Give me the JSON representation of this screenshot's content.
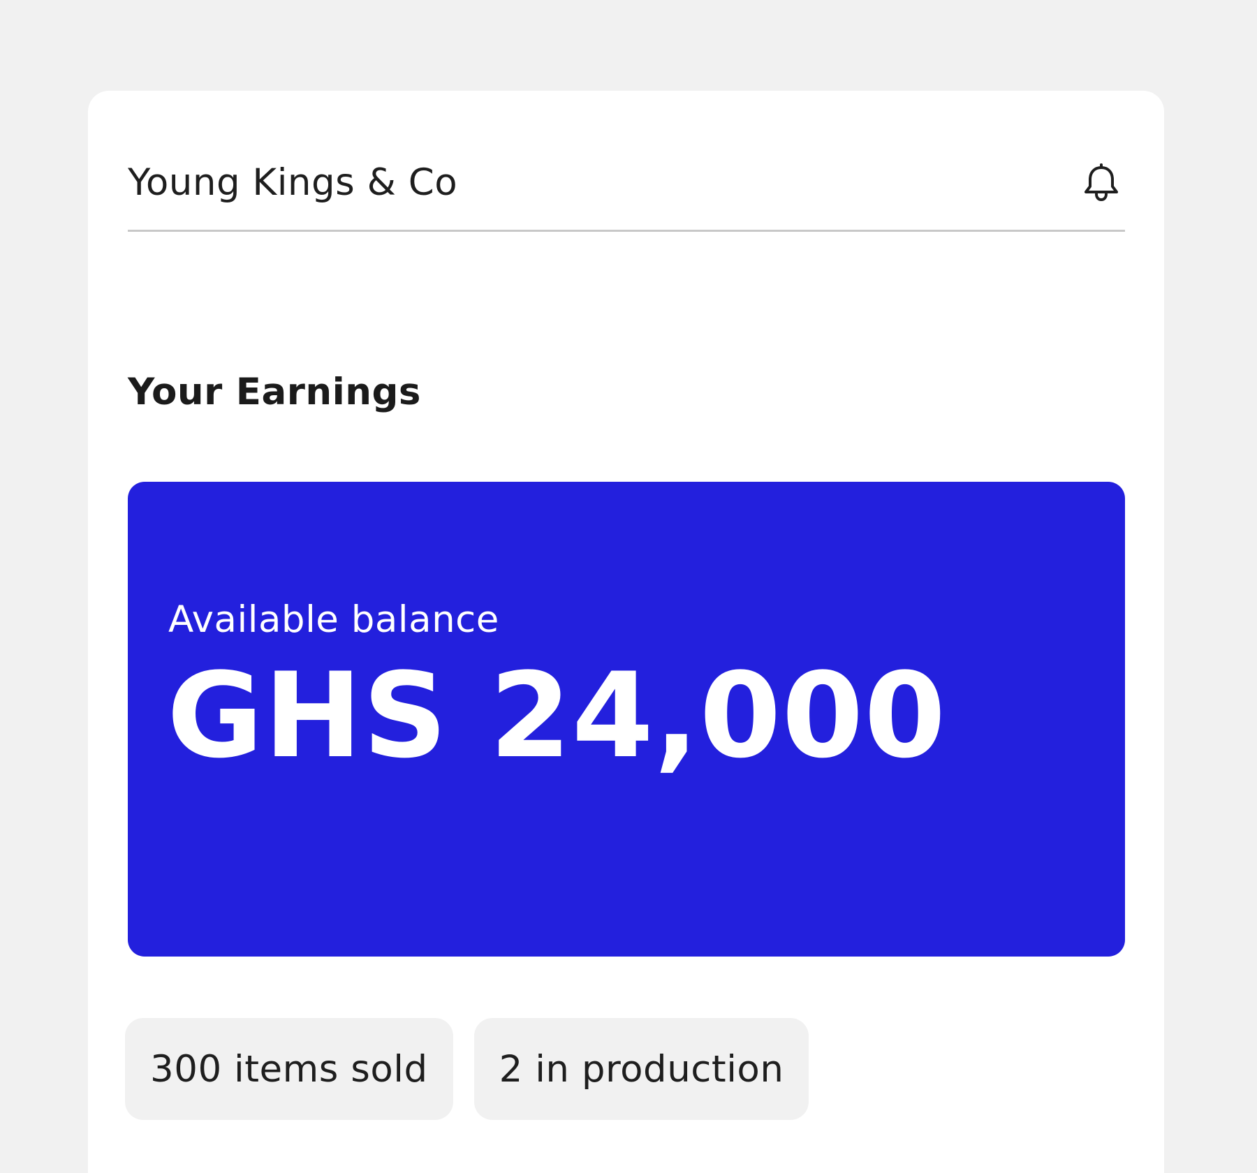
{
  "header": {
    "company_name": "Young Kings & Co",
    "notification_icon": "bell-icon"
  },
  "earnings": {
    "title": "Your Earnings",
    "balance_label": "Available balance",
    "balance_amount": "GHS 24,000",
    "accent_color": "#2320dd"
  },
  "stats": {
    "items_sold": "300 items sold",
    "in_production": "2 in production"
  }
}
